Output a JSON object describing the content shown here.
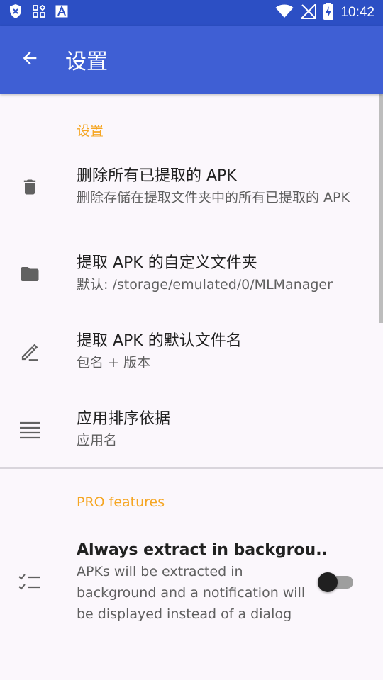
{
  "status_bar": {
    "time": "10:42",
    "left_icons": [
      "shield-x-icon",
      "widgets-icon",
      "font-a-icon"
    ],
    "right_icons": [
      "wifi-icon",
      "signal-off-icon",
      "battery-charging-icon"
    ]
  },
  "app_bar": {
    "title": "设置",
    "back_icon": "arrow-back-icon",
    "color": "#3F5FD4"
  },
  "section1": {
    "header": "设置",
    "items": [
      {
        "icon": "trash-icon",
        "title": "删除所有已提取的 APK",
        "summary": "删除存储在提取文件夹中的所有已提取的 APK"
      },
      {
        "icon": "folder-icon",
        "title": "提取 APK 的自定义文件夹",
        "summary": "默认: /storage/emulated/0/MLManager"
      },
      {
        "icon": "edit-icon",
        "title": "提取 APK 的默认文件名",
        "summary": "包名 + 版本"
      },
      {
        "icon": "sort-lines-icon",
        "title": "应用排序依据",
        "summary": "应用名"
      }
    ]
  },
  "section2": {
    "header": "PRO features",
    "items": [
      {
        "icon": "checklist-icon",
        "title": "Always extract in backgrou..",
        "summary": "APKs will be extracted in background and a notification will be displayed instead of a dialog",
        "switch_on": false
      }
    ]
  },
  "colors": {
    "accent": "#F5A623",
    "status_bar": "#2C4FC4",
    "background": "#FBF7FC"
  }
}
